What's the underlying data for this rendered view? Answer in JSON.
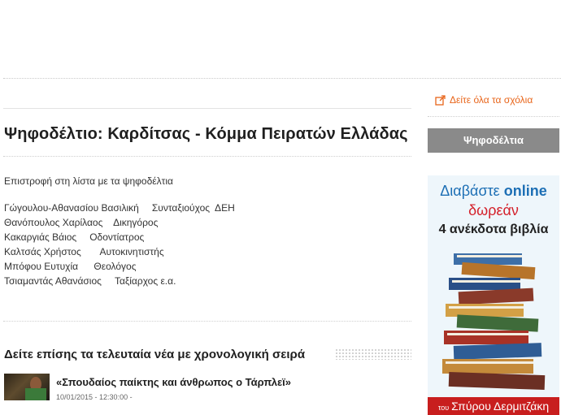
{
  "comments_link": {
    "label": "Δείτε όλα τα σχόλια",
    "icon": "external-link-icon",
    "color": "#e8651a"
  },
  "article": {
    "title": "Ψηφοδέλτιο: Καρδίτσας - Κόμμα Πειρατών Ελλάδας",
    "back_link": "Επιστροφή στη λίστα με τα ψηφοδέλτια",
    "candidates": [
      {
        "name": "Γώγουλου-Αθανασίου Βασιλική",
        "occupation": "Συνταξιούχος  ΔΕΗ"
      },
      {
        "name": "Θανόπουλος Χαρίλαος",
        "occupation": "Δικηγόρος"
      },
      {
        "name": "Κακαργιάς Βάιος",
        "occupation": "Οδοντίατρος"
      },
      {
        "name": "Καλτσάς Χρήστος",
        "occupation": "Αυτοκινητιστής"
      },
      {
        "name": "Μπόφου Ευτυχία",
        "occupation": "Θεολόγος"
      },
      {
        "name": "Τσιαμαντάς Αθανάσιος",
        "occupation": "Ταξίαρχος ε.α."
      }
    ]
  },
  "news": {
    "heading": "Δείτε επίσης τα τελευταία νέα με χρονολογική σειρά",
    "items": [
      {
        "title": "«Σπουδαίος παίκτης και άνθρωπος ο Τάρπλεϊ»",
        "date": "10/01/2015 - 12:30:00 -"
      }
    ]
  },
  "sidebar": {
    "ballots_button": "Ψηφοδέλτια",
    "ad": {
      "line1_a": "Διαβάστε",
      "line1_b": "online",
      "line2": "δωρεάν",
      "line3": "4 ανέκδοτα βιβλία",
      "footer_small": "του",
      "footer_name": "Σπύρου Δερμιτζάκη"
    }
  }
}
